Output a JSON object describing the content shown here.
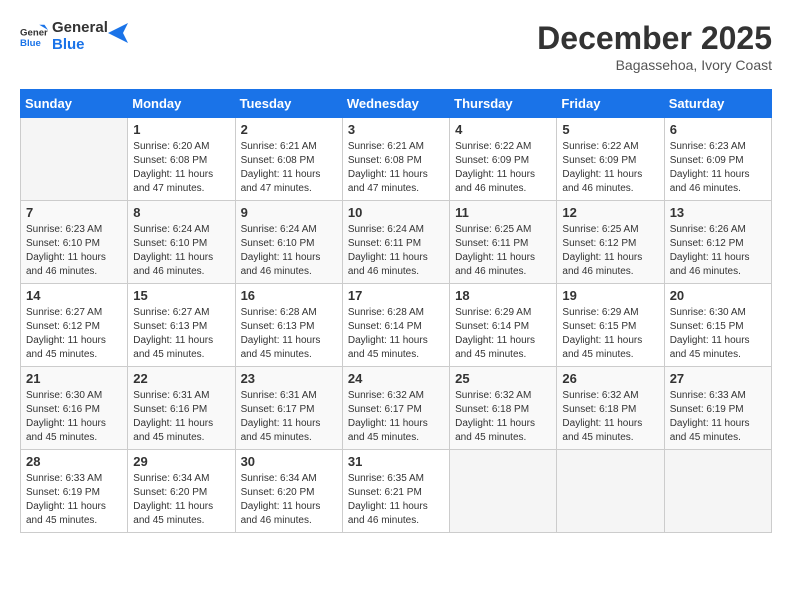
{
  "logo": {
    "line1": "General",
    "line2": "Blue"
  },
  "title": "December 2025",
  "location": "Bagassehoa, Ivory Coast",
  "days_header": [
    "Sunday",
    "Monday",
    "Tuesday",
    "Wednesday",
    "Thursday",
    "Friday",
    "Saturday"
  ],
  "weeks": [
    [
      {
        "num": "",
        "detail": ""
      },
      {
        "num": "1",
        "detail": "Sunrise: 6:20 AM\nSunset: 6:08 PM\nDaylight: 11 hours and 47 minutes."
      },
      {
        "num": "2",
        "detail": "Sunrise: 6:21 AM\nSunset: 6:08 PM\nDaylight: 11 hours and 47 minutes."
      },
      {
        "num": "3",
        "detail": "Sunrise: 6:21 AM\nSunset: 6:08 PM\nDaylight: 11 hours and 47 minutes."
      },
      {
        "num": "4",
        "detail": "Sunrise: 6:22 AM\nSunset: 6:09 PM\nDaylight: 11 hours and 46 minutes."
      },
      {
        "num": "5",
        "detail": "Sunrise: 6:22 AM\nSunset: 6:09 PM\nDaylight: 11 hours and 46 minutes."
      },
      {
        "num": "6",
        "detail": "Sunrise: 6:23 AM\nSunset: 6:09 PM\nDaylight: 11 hours and 46 minutes."
      }
    ],
    [
      {
        "num": "7",
        "detail": "Sunrise: 6:23 AM\nSunset: 6:10 PM\nDaylight: 11 hours and 46 minutes."
      },
      {
        "num": "8",
        "detail": "Sunrise: 6:24 AM\nSunset: 6:10 PM\nDaylight: 11 hours and 46 minutes."
      },
      {
        "num": "9",
        "detail": "Sunrise: 6:24 AM\nSunset: 6:10 PM\nDaylight: 11 hours and 46 minutes."
      },
      {
        "num": "10",
        "detail": "Sunrise: 6:24 AM\nSunset: 6:11 PM\nDaylight: 11 hours and 46 minutes."
      },
      {
        "num": "11",
        "detail": "Sunrise: 6:25 AM\nSunset: 6:11 PM\nDaylight: 11 hours and 46 minutes."
      },
      {
        "num": "12",
        "detail": "Sunrise: 6:25 AM\nSunset: 6:12 PM\nDaylight: 11 hours and 46 minutes."
      },
      {
        "num": "13",
        "detail": "Sunrise: 6:26 AM\nSunset: 6:12 PM\nDaylight: 11 hours and 46 minutes."
      }
    ],
    [
      {
        "num": "14",
        "detail": "Sunrise: 6:27 AM\nSunset: 6:12 PM\nDaylight: 11 hours and 45 minutes."
      },
      {
        "num": "15",
        "detail": "Sunrise: 6:27 AM\nSunset: 6:13 PM\nDaylight: 11 hours and 45 minutes."
      },
      {
        "num": "16",
        "detail": "Sunrise: 6:28 AM\nSunset: 6:13 PM\nDaylight: 11 hours and 45 minutes."
      },
      {
        "num": "17",
        "detail": "Sunrise: 6:28 AM\nSunset: 6:14 PM\nDaylight: 11 hours and 45 minutes."
      },
      {
        "num": "18",
        "detail": "Sunrise: 6:29 AM\nSunset: 6:14 PM\nDaylight: 11 hours and 45 minutes."
      },
      {
        "num": "19",
        "detail": "Sunrise: 6:29 AM\nSunset: 6:15 PM\nDaylight: 11 hours and 45 minutes."
      },
      {
        "num": "20",
        "detail": "Sunrise: 6:30 AM\nSunset: 6:15 PM\nDaylight: 11 hours and 45 minutes."
      }
    ],
    [
      {
        "num": "21",
        "detail": "Sunrise: 6:30 AM\nSunset: 6:16 PM\nDaylight: 11 hours and 45 minutes."
      },
      {
        "num": "22",
        "detail": "Sunrise: 6:31 AM\nSunset: 6:16 PM\nDaylight: 11 hours and 45 minutes."
      },
      {
        "num": "23",
        "detail": "Sunrise: 6:31 AM\nSunset: 6:17 PM\nDaylight: 11 hours and 45 minutes."
      },
      {
        "num": "24",
        "detail": "Sunrise: 6:32 AM\nSunset: 6:17 PM\nDaylight: 11 hours and 45 minutes."
      },
      {
        "num": "25",
        "detail": "Sunrise: 6:32 AM\nSunset: 6:18 PM\nDaylight: 11 hours and 45 minutes."
      },
      {
        "num": "26",
        "detail": "Sunrise: 6:32 AM\nSunset: 6:18 PM\nDaylight: 11 hours and 45 minutes."
      },
      {
        "num": "27",
        "detail": "Sunrise: 6:33 AM\nSunset: 6:19 PM\nDaylight: 11 hours and 45 minutes."
      }
    ],
    [
      {
        "num": "28",
        "detail": "Sunrise: 6:33 AM\nSunset: 6:19 PM\nDaylight: 11 hours and 45 minutes."
      },
      {
        "num": "29",
        "detail": "Sunrise: 6:34 AM\nSunset: 6:20 PM\nDaylight: 11 hours and 45 minutes."
      },
      {
        "num": "30",
        "detail": "Sunrise: 6:34 AM\nSunset: 6:20 PM\nDaylight: 11 hours and 46 minutes."
      },
      {
        "num": "31",
        "detail": "Sunrise: 6:35 AM\nSunset: 6:21 PM\nDaylight: 11 hours and 46 minutes."
      },
      {
        "num": "",
        "detail": ""
      },
      {
        "num": "",
        "detail": ""
      },
      {
        "num": "",
        "detail": ""
      }
    ]
  ]
}
